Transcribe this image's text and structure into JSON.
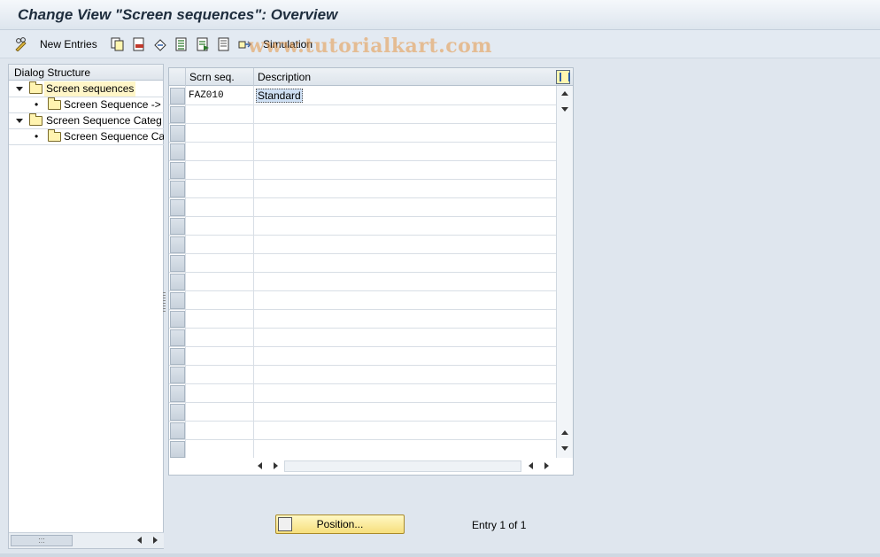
{
  "window": {
    "title": "Change View \"Screen sequences\": Overview"
  },
  "toolbar": {
    "new_entries_label": "New Entries",
    "simulation_label": "Simulation",
    "icons": [
      "edit-glasses-icon",
      "copy-icon",
      "delete-icon",
      "undo-icon",
      "select-all-icon",
      "select-block-icon",
      "deselect-all-icon",
      "transport-icon"
    ]
  },
  "watermark": "www.tutorialkart.com",
  "dialog_structure": {
    "header": "Dialog Structure",
    "items": [
      {
        "label": "Screen sequences",
        "level": 0,
        "expanded": true,
        "selected": true
      },
      {
        "label": "Screen Sequence ->",
        "level": 1,
        "expanded": false,
        "selected": false
      },
      {
        "label": "Screen Sequence Categ",
        "level": 0,
        "expanded": true,
        "selected": false
      },
      {
        "label": "Screen Sequence Ca",
        "level": 1,
        "expanded": false,
        "selected": false
      }
    ]
  },
  "table": {
    "columns": [
      "Scrn seq.",
      "Description"
    ],
    "rows": [
      {
        "scrn_seq": "FAZ010",
        "description": "Standard"
      }
    ],
    "empty_rows": 19
  },
  "footer": {
    "position_button": "Position...",
    "entry_text": "Entry 1 of 1"
  },
  "colors": {
    "title_text": "#1e2d3d",
    "selected_tree": "#fff6c8",
    "button_yellow": "#f6df7c",
    "watermark": "#e69646"
  }
}
